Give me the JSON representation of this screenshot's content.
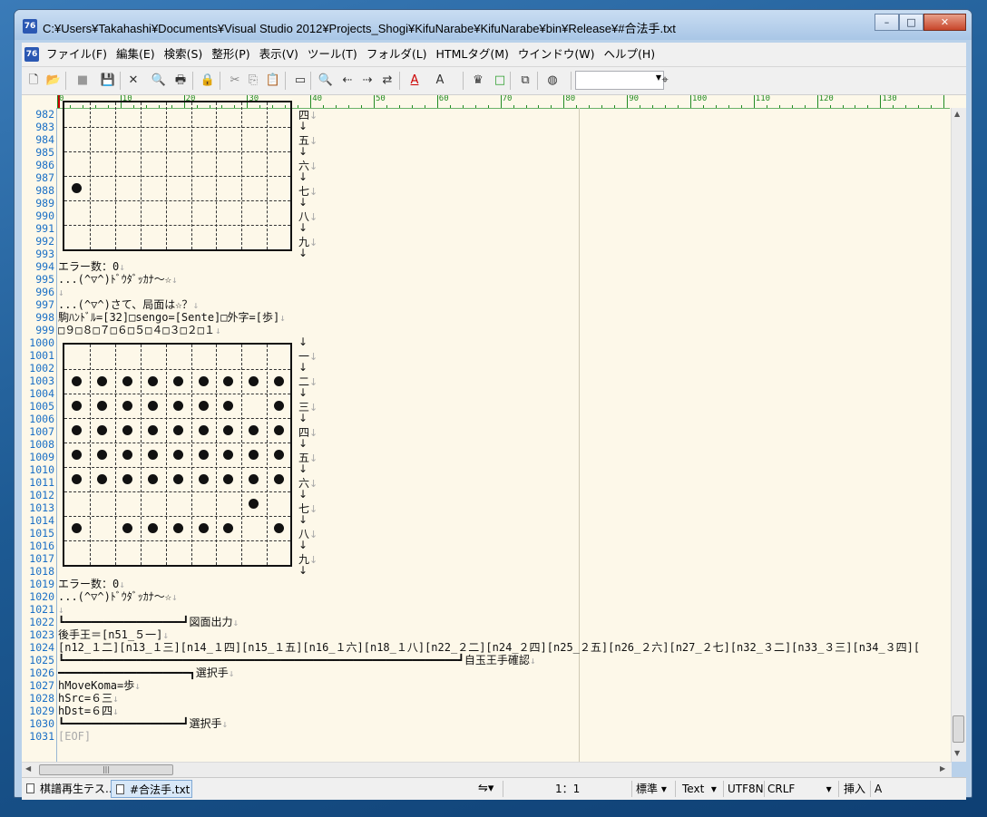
{
  "window": {
    "title": "C:¥Users¥Takahashi¥Documents¥Visual Studio 2012¥Projects_Shogi¥KifuNarabe¥KifuNarabe¥bin¥Release¥#合法手.txt",
    "minimize": "–",
    "maximize": "□",
    "close": "✕"
  },
  "menu": [
    "ファイル(F)",
    "編集(E)",
    "検索(S)",
    "整形(P)",
    "表示(V)",
    "ツール(T)",
    "フォルダ(L)",
    "HTMLタグ(M)",
    "ウインドウ(W)",
    "ヘルプ(H)"
  ],
  "toolbar": {
    "icons": [
      "new-file-icon",
      "open-folder-icon",
      "save-disabled-icon",
      "save-icon",
      "close-icon",
      "print-preview-icon",
      "print-icon",
      "lock-icon",
      "cut-icon",
      "copy-icon",
      "paste-icon",
      "window-icon",
      "find-icon",
      "find-prev-icon",
      "find-next-icon",
      "replace-icon",
      "font-color-icon",
      "highlight-icon",
      "crown-icon",
      "box-icon",
      "copy-pane-icon",
      "globe-icon",
      "binoculars-icon"
    ],
    "search_value": ""
  },
  "ruler": {
    "marks": [
      "0",
      "10",
      "20",
      "30",
      "40",
      "50",
      "60",
      "70",
      "80",
      "90",
      "100",
      "110",
      "120",
      "130"
    ]
  },
  "editor": {
    "line_numbers": [
      "982",
      "983",
      "984",
      "985",
      "986",
      "987",
      "988",
      "989",
      "990",
      "991",
      "992",
      "993",
      "994",
      "995",
      "996",
      "997",
      "998",
      "999",
      "1000",
      "1001",
      "1002",
      "1003",
      "1004",
      "1005",
      "1006",
      "1007",
      "1008",
      "1009",
      "1010",
      "1011",
      "1012",
      "1013",
      "1014",
      "1015",
      "1016",
      "1017",
      "1018",
      "1019",
      "1020",
      "1021",
      "1022",
      "1023",
      "1024",
      "1025",
      "1026",
      "1027",
      "1028",
      "1029",
      "1030",
      "1031"
    ],
    "eol_mark": "↓",
    "board1_ranks": [
      {
        "label": "四",
        "line": 0
      },
      {
        "label": "五",
        "line": 2
      },
      {
        "label": "六",
        "line": 4
      },
      {
        "label": "七",
        "line": 6
      },
      {
        "label": "八",
        "line": 8
      },
      {
        "label": "九",
        "line": 10
      }
    ],
    "board2_ranks": [
      {
        "label": "一",
        "line": 19
      },
      {
        "label": "二",
        "line": 21
      },
      {
        "label": "三",
        "line": 23
      },
      {
        "label": "四",
        "line": 25
      },
      {
        "label": "五",
        "line": 27
      },
      {
        "label": "六",
        "line": 29
      },
      {
        "label": "七",
        "line": 31
      },
      {
        "label": "八",
        "line": 33
      },
      {
        "label": "九",
        "line": 35
      }
    ],
    "text_lines": [
      {
        "line": 12,
        "text": "エラー数：0"
      },
      {
        "line": 13,
        "text": "...(^▽^)ﾄﾞｳﾀﾞｯｶﾅ～☆"
      },
      {
        "line": 14,
        "text": ""
      },
      {
        "line": 15,
        "text": "...(^▽^)さて、局面は☆？"
      },
      {
        "line": 16,
        "text": "駒ﾊﾝﾄﾞﾙ=[32]□sengo=[Sente]□外字=[歩]"
      },
      {
        "line": 17,
        "text": "□９□８□７□６□５□４□３□２□１"
      },
      {
        "line": 37,
        "text": "エラー数：0"
      },
      {
        "line": 38,
        "text": "...(^▽^)ﾄﾞｳﾀﾞｯｶﾅ～☆"
      },
      {
        "line": 39,
        "text": ""
      },
      {
        "line": 40,
        "text": "┗━━━━━━━━━━━━━━━━━━┛図面出力"
      },
      {
        "line": 41,
        "text": "後手王＝[n51_５一]"
      },
      {
        "line": 42,
        "text": "[n12_１二][n13_１三][n14_１四][n15_１五][n16_１六][n18_１八][n22_２二][n24_２四][n25_２五][n26_２六][n27_２七][n32_３二][n33_３三][n34_３四]["
      },
      {
        "line": 43,
        "text": "┗━━━━━━━━━━━━━━━━━━━━━━━━━━━━━━━━━━━━━━━━━━━━━━━━━━━━━━━━━━━━┛自玉王手確認"
      },
      {
        "line": 44,
        "text": "━━━━━━━━━━━━━━━━━━━━┓選択手"
      },
      {
        "line": 45,
        "text": "hMoveKoma=歩"
      },
      {
        "line": 46,
        "text": "hSrc=６三"
      },
      {
        "line": 47,
        "text": "hDst=６四"
      },
      {
        "line": 48,
        "text": "┗━━━━━━━━━━━━━━━━━━┛選択手"
      }
    ],
    "eof": "[EOF]",
    "board1_stones": [
      [
        3,
        0
      ]
    ],
    "board2_stones": [
      [
        1,
        0
      ],
      [
        1,
        1
      ],
      [
        1,
        2
      ],
      [
        1,
        3
      ],
      [
        1,
        4
      ],
      [
        1,
        5
      ],
      [
        1,
        6
      ],
      [
        1,
        7
      ],
      [
        1,
        8
      ],
      [
        2,
        0
      ],
      [
        2,
        1
      ],
      [
        2,
        2
      ],
      [
        2,
        3
      ],
      [
        2,
        4
      ],
      [
        2,
        5
      ],
      [
        2,
        6
      ],
      [
        2,
        8
      ],
      [
        3,
        0
      ],
      [
        3,
        1
      ],
      [
        3,
        2
      ],
      [
        3,
        3
      ],
      [
        3,
        4
      ],
      [
        3,
        5
      ],
      [
        3,
        6
      ],
      [
        3,
        7
      ],
      [
        3,
        8
      ],
      [
        4,
        0
      ],
      [
        4,
        1
      ],
      [
        4,
        2
      ],
      [
        4,
        3
      ],
      [
        4,
        4
      ],
      [
        4,
        5
      ],
      [
        4,
        6
      ],
      [
        4,
        7
      ],
      [
        4,
        8
      ],
      [
        5,
        0
      ],
      [
        5,
        1
      ],
      [
        5,
        2
      ],
      [
        5,
        3
      ],
      [
        5,
        4
      ],
      [
        5,
        5
      ],
      [
        5,
        6
      ],
      [
        5,
        7
      ],
      [
        5,
        8
      ],
      [
        6,
        7
      ],
      [
        7,
        0
      ],
      [
        7,
        2
      ],
      [
        7,
        3
      ],
      [
        7,
        4
      ],
      [
        7,
        5
      ],
      [
        7,
        6
      ],
      [
        7,
        8
      ]
    ]
  },
  "tabs": [
    {
      "label": "棋譜再生テス...",
      "active": false
    },
    {
      "label": "#合法手.txt",
      "active": true
    }
  ],
  "status": {
    "position": "1：1",
    "mode": "標準",
    "type": "Text",
    "encoding": "UTF8N",
    "newline": "CRLF",
    "insert": "挿入",
    "ime": "A"
  }
}
